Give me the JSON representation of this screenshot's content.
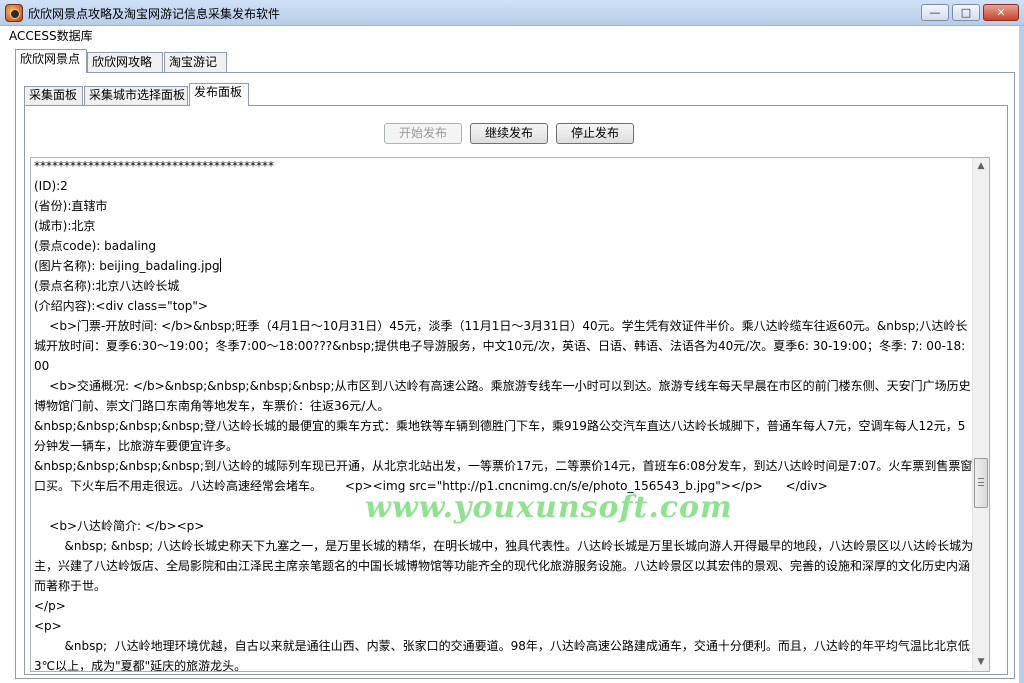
{
  "window": {
    "title": "欣欣网景点攻略及淘宝网游记信息采集发布软件",
    "controls": {
      "minimize": "—",
      "maximize": "□",
      "close": "✕"
    }
  },
  "menu": {
    "items": [
      "ACCESS数据库"
    ]
  },
  "outer_tabs": [
    "欣欣网景点",
    "欣欣网攻略",
    "淘宝游记"
  ],
  "inner_tabs": [
    "采集面板",
    "采集城市选择面板",
    "发布面板"
  ],
  "buttons": {
    "start": "开始发布",
    "continue": "继续发布",
    "stop": "停止发布"
  },
  "log": {
    "lines": [
      "****************************************",
      "(ID):2",
      "(省份):直辖市",
      "(城市):北京",
      "(景点code): badaling",
      "(图片名称): beijing_badaling.jpg",
      "(景点名称):北京八达岭长城",
      "(介绍内容):<div class=\"top\">",
      "    <b>门票-开放时间: </b>&nbsp;旺季（4月1日～10月31日）45元，淡季（11月1日～3月31日）40元。学生凭有效证件半价。乘八达岭缆车往返60元。&nbsp;八达岭长城开放时间：夏季6:30～19:00；冬季7:00～18:00???&nbsp;提供电子导游服务，中文10元/次，英语、日语、韩语、法语各为40元/次。夏季6: 30-19:00；冬季: 7: 00-18: 00",
      "    <b>交通概况: </b>&nbsp;&nbsp;&nbsp;&nbsp;从市区到八达岭有高速公路。乘旅游专线车一小时可以到达。旅游专线车每天早晨在市区的前门楼东侧、天安门广场历史博物馆门前、崇文门路口东南角等地发车，车票价：往返36元/人。",
      "&nbsp;&nbsp;&nbsp;&nbsp;登八达岭长城的最便宜的乘车方式：乘地铁等车辆到德胜门下车，乘919路公交汽车直达八达岭长城脚下，普通车每人7元，空调车每人12元，5分钟发一辆车，比旅游车要便宜许多。",
      "&nbsp;&nbsp;&nbsp;&nbsp;到八达岭的城际列车现已开通，从北京北站出发，一等票价17元，二等票价14元，首班车6:08分发车，到达八达岭时间是7:07。火车票到售票窗口买。下火车后不用走很远。八达岭高速经常会堵车。      <p><img src=\"http://p1.cncnimg.cn/s/e/photo_156543_b.jpg\"></p>      </div>",
      "",
      "    <b>八达岭简介: </b><p>",
      "        &nbsp; &nbsp; 八达岭长城史称天下九塞之一，是万里长城的精华，在明长城中，独具代表性。八达岭长城是万里长城向游人开得最早的地段，八达岭景区以八达岭长城为主，兴建了八达岭饭店、全局影院和由江泽民主席亲笔题名的中国长城博物馆等功能齐全的现代化旅游服务设施。八达岭景区以其宏伟的景观、完善的设施和深厚的文化历史内涵而著称于世。",
      "</p>",
      "<p>",
      "        &nbsp;  八达岭地理环境优越，自古以来就是通往山西、内蒙、张家口的交通要道。98年，八达岭高速公路建成通车，交通十分便利。而且，八达岭的年平均气温比北京低3℃以上，成为\"夏都\"延庆的旅游龙头。"
    ]
  },
  "watermark": "www.youxunsoft.com"
}
